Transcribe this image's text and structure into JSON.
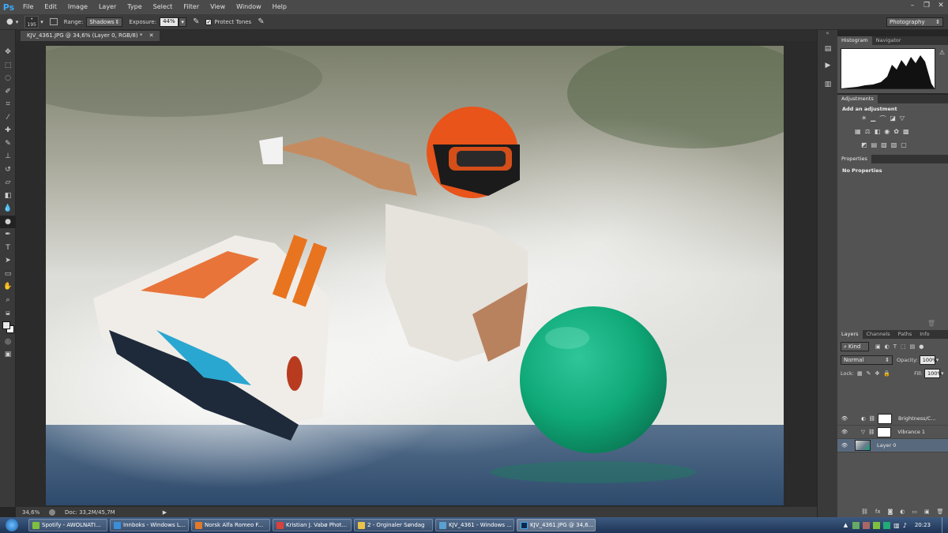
{
  "app": {
    "logo": "Ps"
  },
  "menu": [
    "File",
    "Edit",
    "Image",
    "Layer",
    "Type",
    "Select",
    "Filter",
    "View",
    "Window",
    "Help"
  ],
  "options": {
    "brush_size": "195",
    "range_label": "Range:",
    "range_value": "Shadows",
    "exposure_label": "Exposure:",
    "exposure_value": "44%",
    "protect_tones": "Protect Tones",
    "workspace": "Photography"
  },
  "document": {
    "tab": "KJV_4361.JPG @ 34,6% (Layer 0, RGB/8) *"
  },
  "status": {
    "zoom": "34,6%",
    "doc": "Doc: 33,2M/45,7M"
  },
  "panels": {
    "histogram_tabs": [
      "Histogram",
      "Navigator"
    ],
    "adjustments_tab": "Adjustments",
    "add_adjustment": "Add an adjustment",
    "properties_tab": "Properties",
    "no_properties": "No Properties",
    "layers_tabs": [
      "Layers",
      "Channels",
      "Paths",
      "Info"
    ],
    "kind": "Kind",
    "blend_mode": "Normal",
    "opacity_label": "Opacity:",
    "opacity_value": "100%",
    "lock_label": "Lock:",
    "fill_label": "Fill:",
    "fill_value": "100%",
    "layers": [
      "Brightness/C...",
      "Vibrance 1",
      "Layer 0"
    ]
  },
  "taskbar": {
    "tasks": [
      "Spotify - AWOLNATI...",
      "Innboks - Windows L...",
      "Norsk Alfa Romeo F...",
      "Kristian J. Vabø Phot...",
      "2 - Orginaler Søndag",
      "KJV_4361 - Windows ...",
      "KJV_4361.JPG @ 34,6..."
    ],
    "clock": "20:23"
  }
}
